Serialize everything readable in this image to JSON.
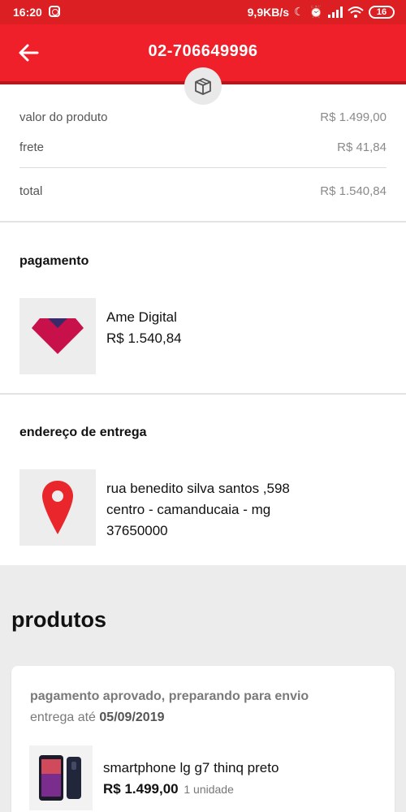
{
  "status_bar": {
    "time": "16:20",
    "network_speed": "9,9KB/s",
    "battery": "16",
    "icons": [
      "instagram-icon",
      "moon-icon",
      "alarm-icon",
      "signal-icon",
      "wifi-icon",
      "battery-icon"
    ]
  },
  "header": {
    "title": "02-706649996",
    "back_icon": "arrow-left-icon",
    "badge_icon": "box-icon",
    "color": "#f0202a"
  },
  "summary": {
    "product_label": "valor do produto",
    "product_value": "R$ 1.499,00",
    "shipping_label": "frete",
    "shipping_value": "R$ 41,84",
    "total_label": "total",
    "total_value": "R$ 1.540,84"
  },
  "payment": {
    "title": "pagamento",
    "method": "Ame Digital",
    "amount": "R$ 1.540,84",
    "icon": "ame-digital-logo-icon",
    "logo_color": "#c8104a"
  },
  "address": {
    "title": "endereço de entrega",
    "line1": "rua benedito silva santos ,598",
    "line2": "centro - camanducaia - mg",
    "line3": "37650000",
    "icon": "location-pin-icon",
    "pin_color": "#e8262b"
  },
  "products": {
    "title": "produtos",
    "items": [
      {
        "status": "pagamento aprovado, preparando para envio",
        "delivery_prefix": "entrega até",
        "delivery_date": "05/09/2019",
        "name": "smartphone lg g7 thinq preto",
        "price": "R$ 1.499,00",
        "quantity": "1 unidade",
        "icon": "smartphone-image"
      }
    ]
  }
}
